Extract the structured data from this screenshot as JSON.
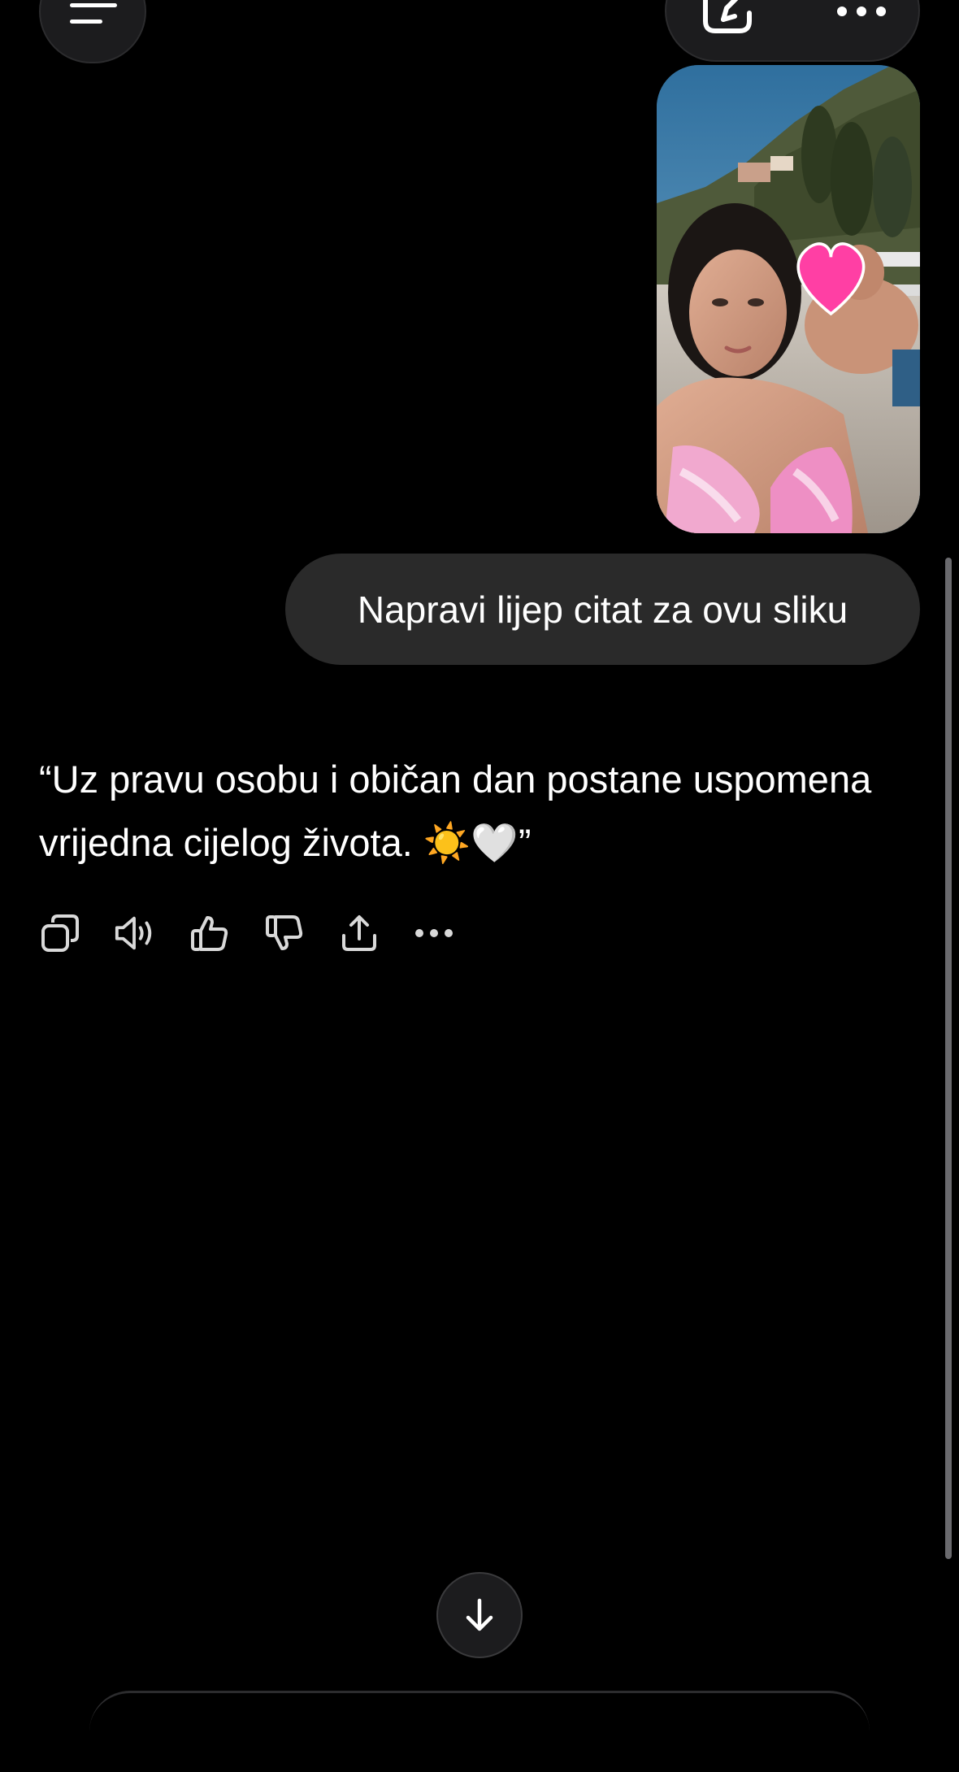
{
  "header": {
    "menu_icon": "menu-lines-icon",
    "edit_icon": "edit-pencil-icon",
    "more_icon": "more-horizontal-icon"
  },
  "conversation": {
    "user_image": {
      "icon": "heart-emoji-sticker",
      "description_visible": false
    },
    "user_message": "Napravi lijep citat za ovu sliku",
    "assistant_reply": "“Uz pravu osobu i običan dan postane uspomena vrijedna cijelog života. ☀️🤍”"
  },
  "reply_actions": [
    {
      "name": "copy-icon"
    },
    {
      "name": "read-aloud-icon"
    },
    {
      "name": "thumbs-up-icon"
    },
    {
      "name": "thumbs-down-icon"
    },
    {
      "name": "share-icon"
    },
    {
      "name": "more-horizontal-icon"
    }
  ],
  "scroll_down_icon": "arrow-down-icon",
  "colors": {
    "background": "#000000",
    "bubble": "#2a2a2a",
    "button": "#1c1c1e",
    "text": "#ffffff"
  }
}
